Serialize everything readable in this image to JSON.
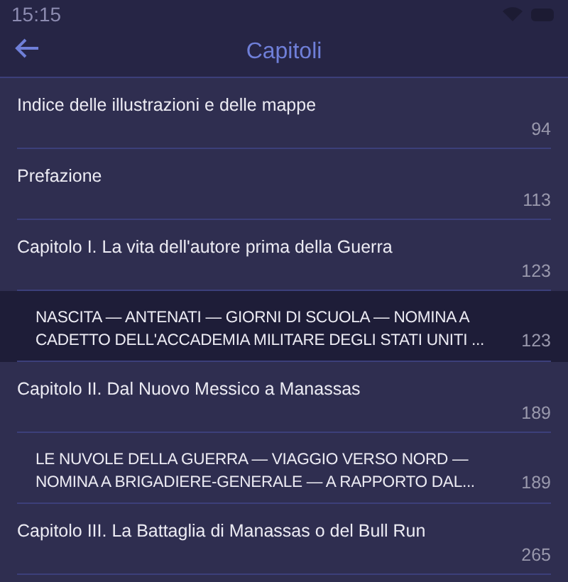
{
  "status_bar": {
    "time": "15:15"
  },
  "header": {
    "title": "Capitoli"
  },
  "chapters": [
    {
      "kind": "chapter",
      "title": "Indice delle illustrazioni e delle mappe",
      "page": "94",
      "selected": false
    },
    {
      "kind": "chapter",
      "title": "Prefazione",
      "page": "113",
      "selected": false
    },
    {
      "kind": "chapter",
      "title": "Capitolo I. La vita dell'autore prima della Guerra",
      "page": "123",
      "selected": false
    },
    {
      "kind": "summary",
      "title": "NASCITA — ANTENATI — GIORNI DI SCUOLA — NOMINA A CADETTO DELL'ACCADEMIA MILITARE DEGLI STATI UNITI ...",
      "page": "123",
      "selected": true
    },
    {
      "kind": "chapter",
      "title": "Capitolo II. Dal Nuovo Messico a Manassas",
      "page": "189",
      "selected": false
    },
    {
      "kind": "summary",
      "title": "LE NUVOLE DELLA GUERRA — VIAGGIO VERSO NORD — NOMINA A BRIGADIERE-GENERALE — A RAPPORTO DAL...",
      "page": "189",
      "selected": false
    },
    {
      "kind": "chapter",
      "title": "Capitolo III. La Battaglia di Manassas o del Bull Run",
      "page": "265",
      "selected": false
    }
  ]
}
